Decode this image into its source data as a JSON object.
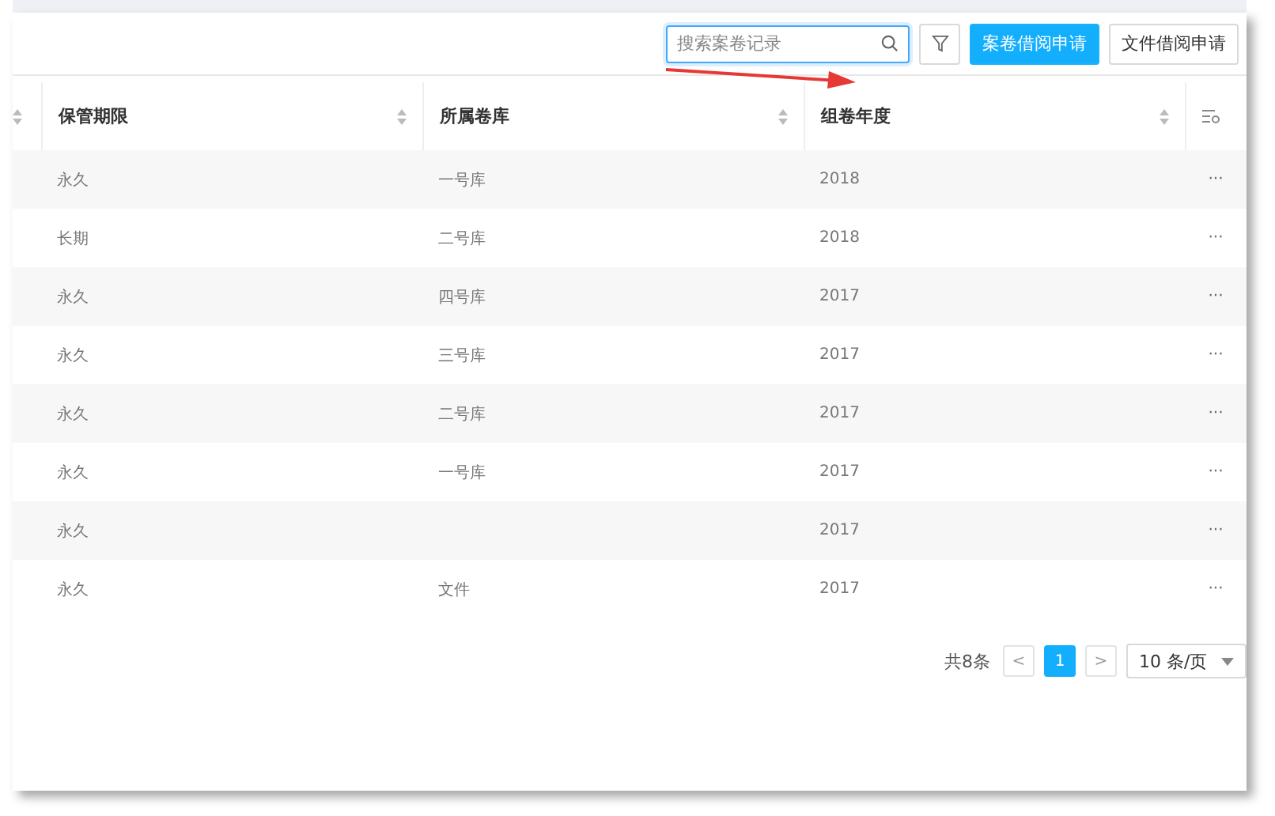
{
  "toolbar": {
    "search": {
      "placeholder": "搜索案卷记录"
    },
    "buttons": [
      {
        "label": "案卷借阅申请",
        "kind": "primary"
      },
      {
        "label": "文件借阅申请",
        "kind": "default"
      }
    ]
  },
  "table": {
    "columns": [
      "保管期限",
      "所属卷库",
      "组卷年度"
    ],
    "rows": [
      {
        "cells": [
          "永久",
          "一号库",
          "2018"
        ],
        "action": "···"
      },
      {
        "cells": [
          "长期",
          "二号库",
          "2018"
        ],
        "action": "···"
      },
      {
        "cells": [
          "永久",
          "四号库",
          "2017"
        ],
        "action": "···"
      },
      {
        "cells": [
          "永久",
          "三号库",
          "2017"
        ],
        "action": "···"
      },
      {
        "cells": [
          "永久",
          "二号库",
          "2017"
        ],
        "action": "···"
      },
      {
        "cells": [
          "永久",
          "一号库",
          "2017"
        ],
        "action": "···"
      },
      {
        "cells": [
          "永久",
          "",
          "2017"
        ],
        "action": "···"
      },
      {
        "cells": [
          "永久",
          "文件",
          "2017"
        ],
        "action": "···"
      }
    ]
  },
  "pagination": {
    "total": "共8条",
    "prev": "<",
    "pages": [
      {
        "label": "1",
        "selected": true
      }
    ],
    "next": ">",
    "page_size": "10 条/页"
  }
}
